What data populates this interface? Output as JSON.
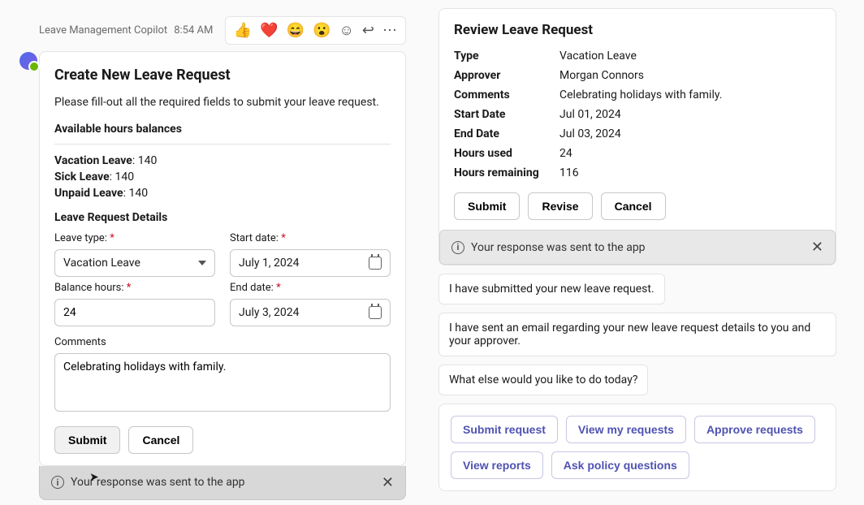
{
  "left": {
    "sender": "Leave Management Copilot",
    "time": "8:54 AM",
    "reactions": {
      "e1": "👍",
      "e2": "❤️",
      "e3": "😄",
      "e4": "😮"
    },
    "card": {
      "title": "Create New Leave Request",
      "subtext": "Please fill-out all the required fields to submit your leave request.",
      "balances_title": "Available hours balances",
      "balances": {
        "vacation_label": "Vacation Leave",
        "vacation_val": ": 140",
        "sick_label": "Sick Leave",
        "sick_val": ": 140",
        "unpaid_label": "Unpaid Leave",
        "unpaid_val": ": 140"
      },
      "details_title": "Leave Request Details",
      "fields": {
        "leave_type_label": "Leave type:",
        "leave_type_value": "Vacation Leave",
        "start_date_label": "Start date:",
        "start_date_value": "July 1, 2024",
        "balance_hours_label": "Balance hours:",
        "balance_hours_value": "24",
        "end_date_label": "End date:",
        "end_date_value": "July 3, 2024",
        "comments_label": "Comments",
        "comments_value": "Celebrating holidays with family."
      },
      "buttons": {
        "submit": "Submit",
        "cancel": "Cancel"
      }
    },
    "toast": "Your response was sent to the app"
  },
  "right": {
    "card": {
      "title": "Review Leave Request",
      "kv": {
        "type_k": "Type",
        "type_v": "Vacation Leave",
        "approver_k": "Approver",
        "approver_v": "Morgan Connors",
        "comments_k": "Comments",
        "comments_v": "Celebrating holidays with family.",
        "start_k": "Start Date",
        "start_v": "Jul 01, 2024",
        "end_k": "End Date",
        "end_v": "Jul 03, 2024",
        "used_k": "Hours used",
        "used_v": "24",
        "remain_k": "Hours remaining",
        "remain_v": "116"
      },
      "buttons": {
        "submit": "Submit",
        "revise": "Revise",
        "cancel": "Cancel"
      },
      "toast": "Your response was sent to the app"
    },
    "messages": {
      "m1": "I have submitted your new leave request.",
      "m2": "I have sent an email regarding your new leave request details to you and your approver.",
      "m3": "What else would you like to do today?"
    },
    "suggestions": {
      "s1": "Submit request",
      "s2": "View my requests",
      "s3": "Approve requests",
      "s4": "View reports",
      "s5": "Ask policy questions"
    }
  }
}
